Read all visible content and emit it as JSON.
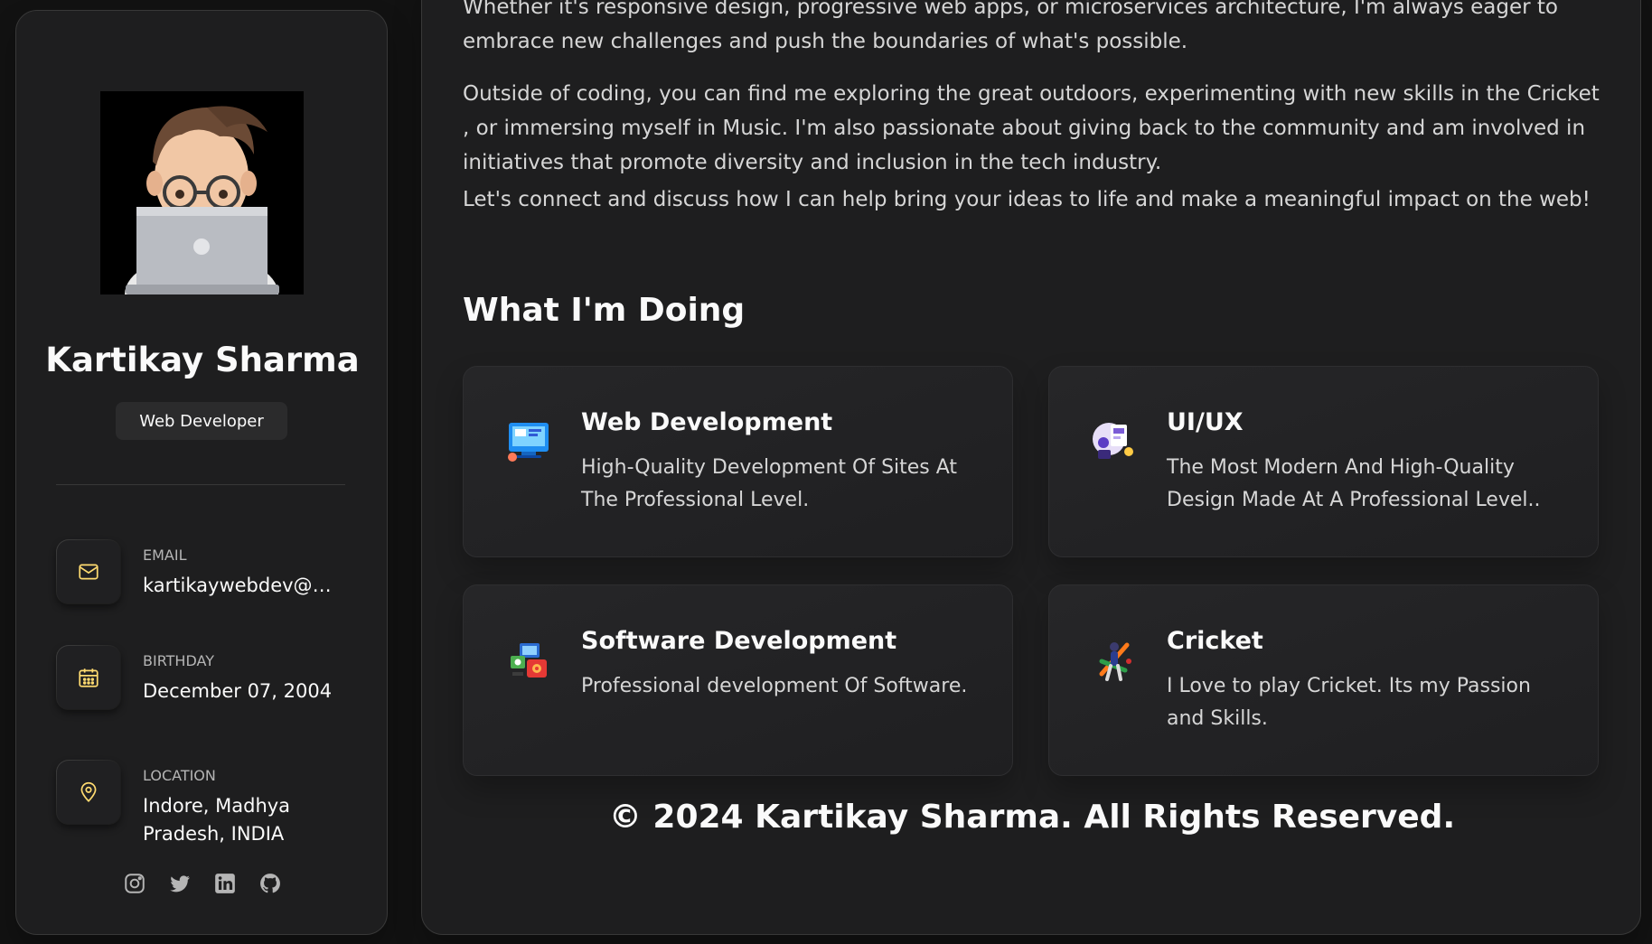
{
  "profile": {
    "name": "Kartikay Sharma",
    "role": "Web Developer"
  },
  "contacts": [
    {
      "title": "Email",
      "value": "kartikaywebdev@gmail.com",
      "icon": "mail-icon"
    },
    {
      "title": "Birthday",
      "value": "December 07, 2004",
      "icon": "calendar-icon"
    },
    {
      "title": "Location",
      "value": "Indore, Madhya Pradesh, INDIA",
      "icon": "location-pin-icon"
    }
  ],
  "socials": [
    "instagram-icon",
    "twitter-icon",
    "linkedin-icon",
    "github-icon"
  ],
  "about": {
    "paragraphs": [
      "Whether it's responsive design, progressive web apps, or microservices architecture, I'm always eager to embrace new challenges and push the boundaries of what's possible.",
      "Outside of coding, you can find me exploring the great outdoors, experimenting with new skills in the Cricket , or immersing myself in Music. I'm also passionate about giving back to the community and am involved in initiatives that promote diversity and inclusion in the tech industry.",
      "Let's connect and discuss how I can help bring your ideas to life and make a meaningful impact on the web!"
    ]
  },
  "services": {
    "title": "What I'm Doing",
    "items": [
      {
        "title": "Web Development",
        "text": "High-Quality Development Of Sites At The Professional Level.",
        "icon": "web-development-icon"
      },
      {
        "title": "UI/UX",
        "text": "The Most Modern And High-Quality Design Made At A Professional Level..",
        "icon": "ui-ux-design-icon"
      },
      {
        "title": "Software Development",
        "text": "Professional development Of Software.",
        "icon": "software-development-icon"
      },
      {
        "title": "Cricket",
        "text": "I Love to play Cricket. Its my Passion and Skills.",
        "icon": "cricket-icon"
      }
    ]
  },
  "footer": {
    "text": "© 2024 Kartikay Sharma. All Rights Reserved."
  },
  "colors": {
    "accent": "#ffdb70",
    "card_bg": "#1e1e1f",
    "page_bg": "#121212"
  }
}
